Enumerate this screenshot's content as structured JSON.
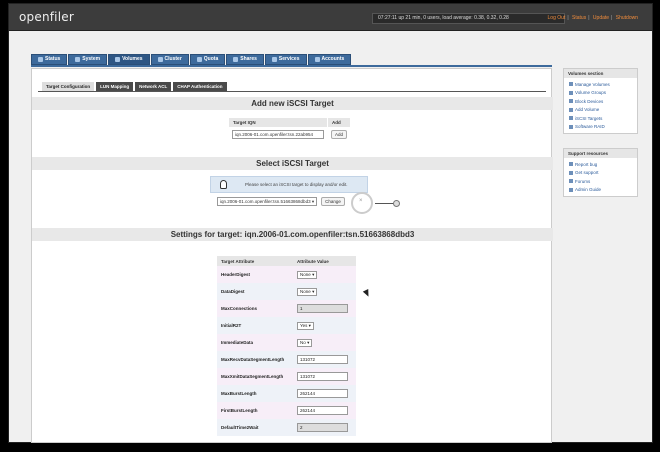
{
  "app": {
    "logo": "openfiler"
  },
  "topbar": {
    "status": "07:27:11 up 21 min, 0 users, load average: 0.38, 0.32, 0.28",
    "links": [
      "Log Out",
      "Status",
      "Update",
      "Shutdown"
    ]
  },
  "nav": {
    "tabs": [
      "Status",
      "System",
      "Volumes",
      "Cluster",
      "Quota",
      "Shares",
      "Services",
      "Accounts"
    ],
    "active": "Volumes"
  },
  "subtabs": [
    "Target Configuration",
    "LUN Mapping",
    "Network ACL",
    "CHAP Authentication"
  ],
  "add_target": {
    "title": "Add new iSCSI Target",
    "col_iqn": "Target IQN",
    "col_add": "Add",
    "iqn_value": "iqn.2006-01.com.openfiler:tsn.22ab954",
    "add_button": "Add"
  },
  "select_target": {
    "title": "Select iSCSI Target",
    "info": "Please select an iSCSI target to display and/or edit.",
    "selected": "iqn.2006-01.com.openfiler:tsn.51663868dbd3",
    "change_button": "Change"
  },
  "settings": {
    "title": "Settings for target: iqn.2006-01.com.openfiler:tsn.51663868dbd3",
    "col_attr": "Target Attribute",
    "col_val": "Attribute Value",
    "rows": [
      {
        "name": "HeaderDigest",
        "value": "None",
        "kind": "select"
      },
      {
        "name": "DataDigest",
        "value": "None",
        "kind": "select"
      },
      {
        "name": "MaxConnections",
        "value": "1",
        "kind": "disabled"
      },
      {
        "name": "InitialR2T",
        "value": "Yes",
        "kind": "select"
      },
      {
        "name": "ImmediateData",
        "value": "No",
        "kind": "select"
      },
      {
        "name": "MaxRecvDataSegmentLength",
        "value": "131072",
        "kind": "text"
      },
      {
        "name": "MaxXmitDataSegmentLength",
        "value": "131072",
        "kind": "text"
      },
      {
        "name": "MaxBurstLength",
        "value": "262144",
        "kind": "text"
      },
      {
        "name": "FirstBurstLength",
        "value": "262144",
        "kind": "text"
      },
      {
        "name": "DefaultTime2Wait",
        "value": "2",
        "kind": "disabled"
      }
    ]
  },
  "sidebar": {
    "volumes": {
      "title": "Volumes section",
      "items": [
        "Manage Volumes",
        "Volume Groups",
        "Block Devices",
        "Add Volume",
        "iSCSI Targets",
        "Software RAID"
      ]
    },
    "support": {
      "title": "Support resources",
      "items": [
        "Report bug",
        "Get support",
        "Forums",
        "Admin Guide"
      ]
    }
  },
  "colors": {
    "nav": "#3d6a9c",
    "link": "#2a5a9a",
    "toplink": "#f08c3c"
  }
}
